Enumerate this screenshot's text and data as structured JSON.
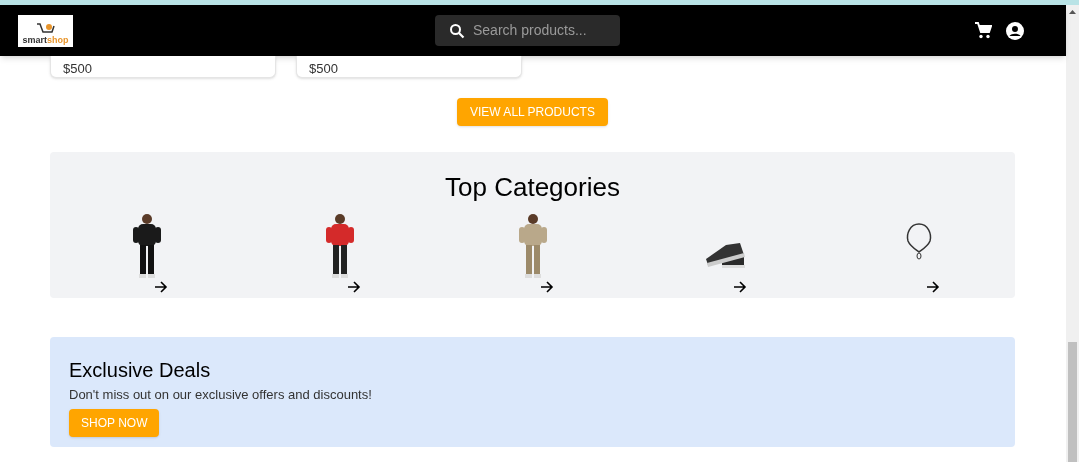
{
  "header": {
    "logo": {
      "part_1": "smart",
      "part_2": "shop"
    },
    "search": {
      "placeholder": "Search products..."
    }
  },
  "product_cards": [
    {
      "price": "$500"
    },
    {
      "price": "$500"
    }
  ],
  "view_all_button": "VIEW ALL PRODUCTS",
  "top_categories": {
    "title": "Top Categories",
    "items": [
      {
        "kind": "person"
      },
      {
        "kind": "person"
      },
      {
        "kind": "person"
      },
      {
        "kind": "shoe"
      },
      {
        "kind": "necklace"
      }
    ]
  },
  "deals": {
    "title": "Exclusive Deals",
    "text": "Don't miss out on our exclusive offers and discounts!",
    "button": "SHOP NOW"
  }
}
